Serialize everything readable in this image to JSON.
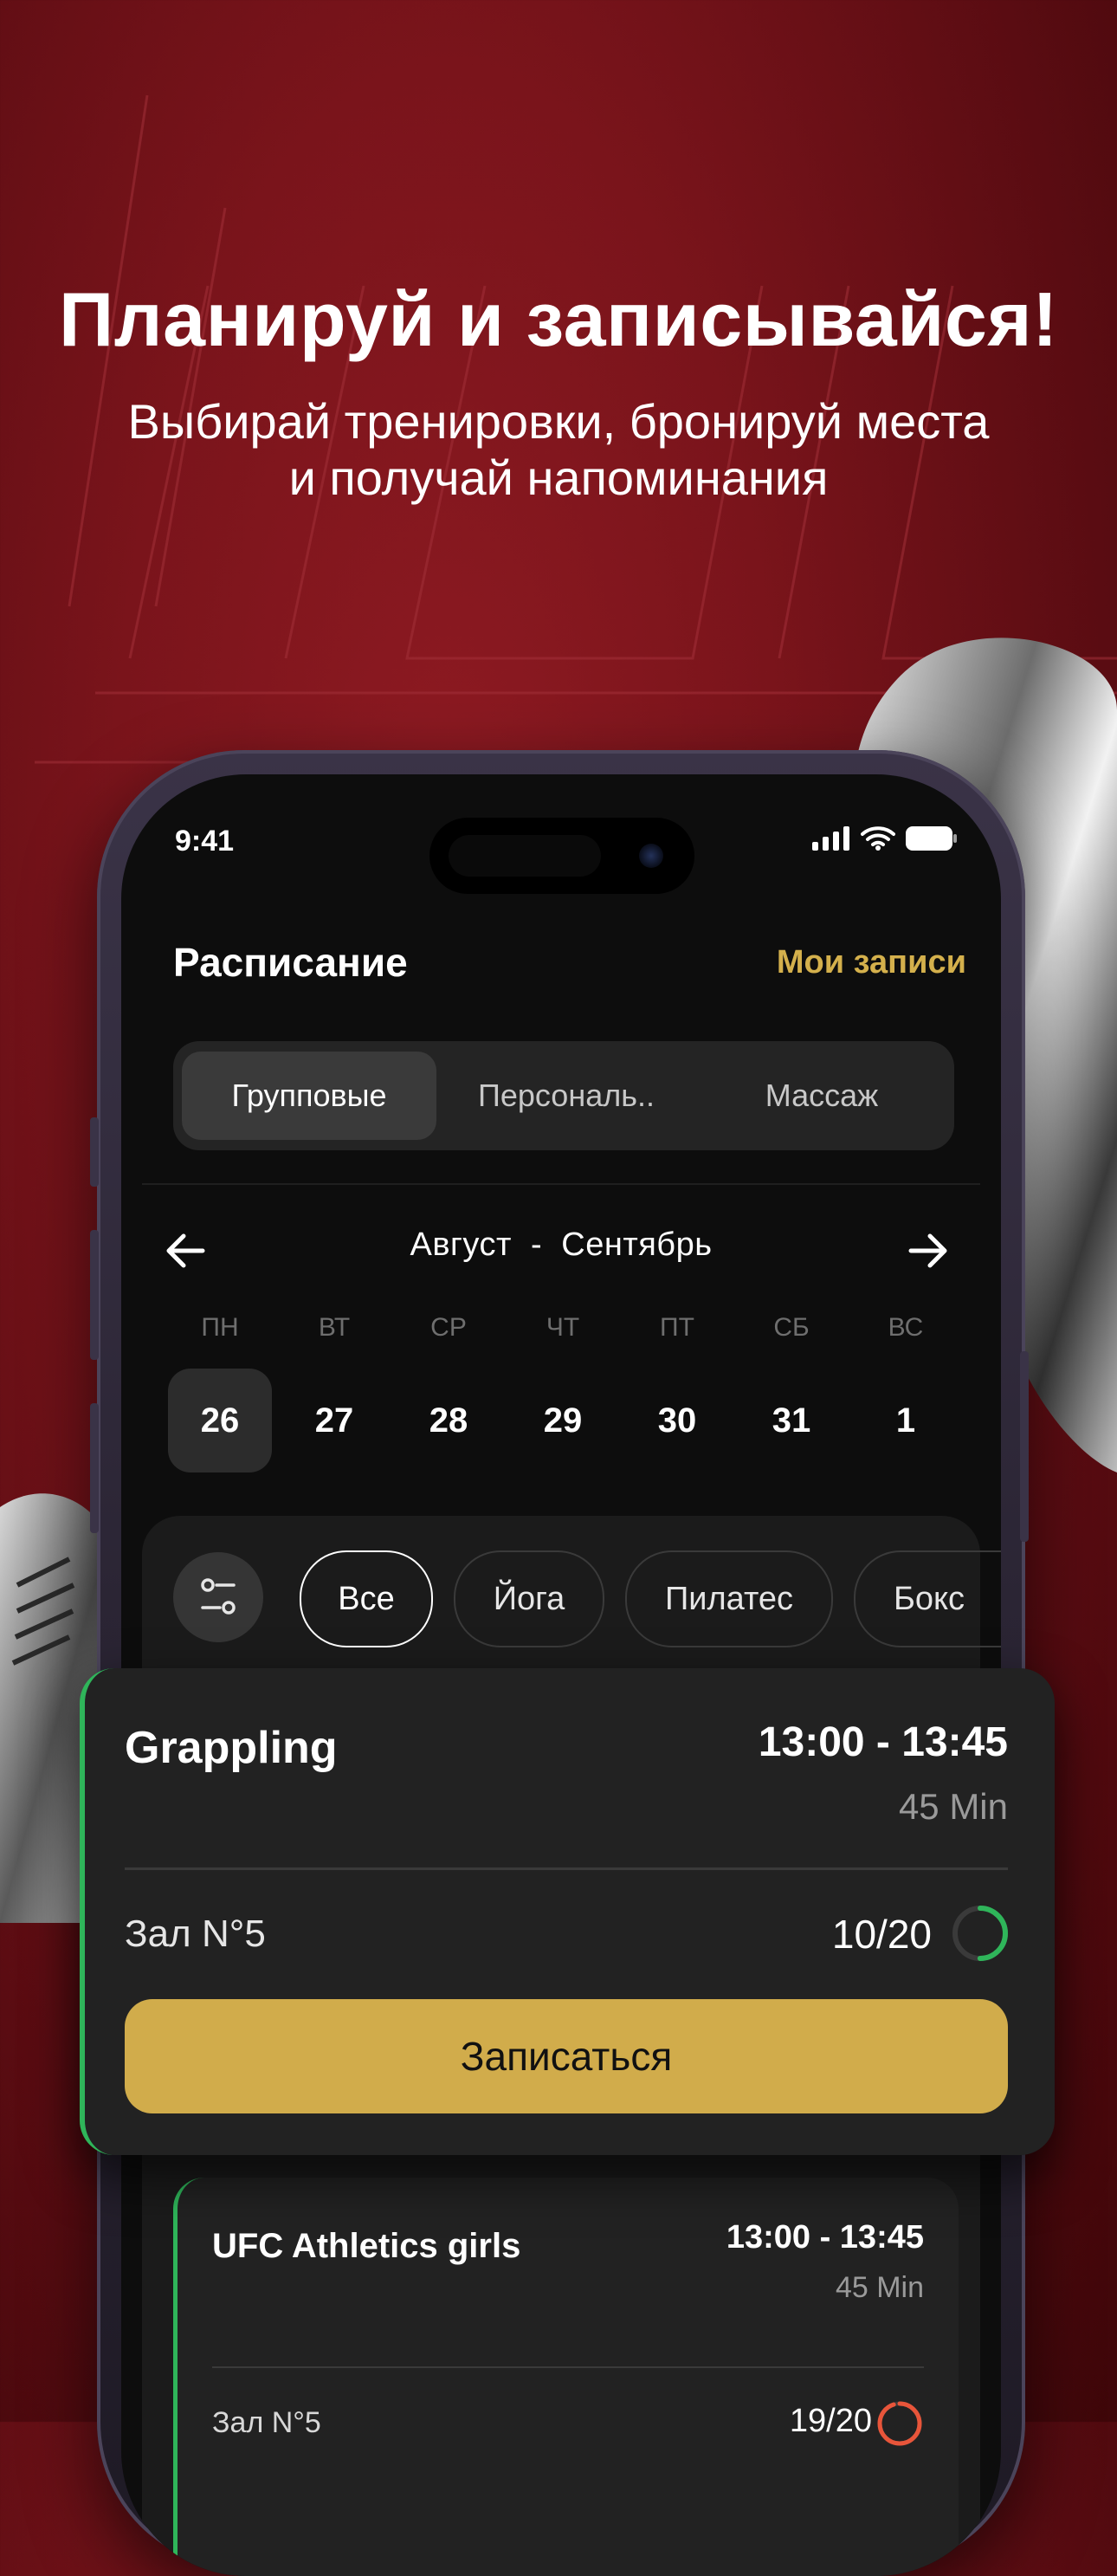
{
  "hero": {
    "title": "Планируй и записывайся!",
    "subtitle_line1": "Выбирай тренировки, бронируй места",
    "subtitle_line2": "и получай напоминания"
  },
  "status_bar": {
    "time": "9:41"
  },
  "header": {
    "title": "Расписание",
    "my_records": "Мои записи"
  },
  "tabs": [
    {
      "label": "Групповые",
      "active": true
    },
    {
      "label": "Персональ..",
      "active": false
    },
    {
      "label": "Массаж",
      "active": false
    }
  ],
  "calendar": {
    "range_start": "Август",
    "range_sep": "-",
    "range_end": "Сентябрь",
    "weekdays": [
      "ПН",
      "ВТ",
      "СР",
      "ЧТ",
      "ПТ",
      "СБ",
      "ВС"
    ],
    "days": [
      "26",
      "27",
      "28",
      "29",
      "30",
      "31",
      "1"
    ],
    "selected_index": 0
  },
  "filters": {
    "chips": [
      {
        "label": "Все",
        "active": true
      },
      {
        "label": "Йога",
        "active": false
      },
      {
        "label": "Пилатес",
        "active": false
      },
      {
        "label": "Бокс",
        "active": false
      }
    ]
  },
  "featured_card": {
    "title": "Grappling",
    "time": "13:00 - 13:45",
    "duration": "45 Min",
    "room": "Зал N°5",
    "capacity": "10/20",
    "fill": 0.5,
    "button": "Записаться",
    "accent": "#2fb55a",
    "button_color": "#d1ac4b"
  },
  "second_card": {
    "title": "UFC Athletics girls",
    "time": "13:00 - 13:45",
    "duration": "45 Min",
    "room": "Зал N°5",
    "capacity": "19/20",
    "fill": 0.95,
    "ring_color": "#e8553a"
  },
  "colors": {
    "accent_gold": "#d4b04c",
    "status_green": "#2fb55a",
    "background_red": "#7a141b"
  }
}
